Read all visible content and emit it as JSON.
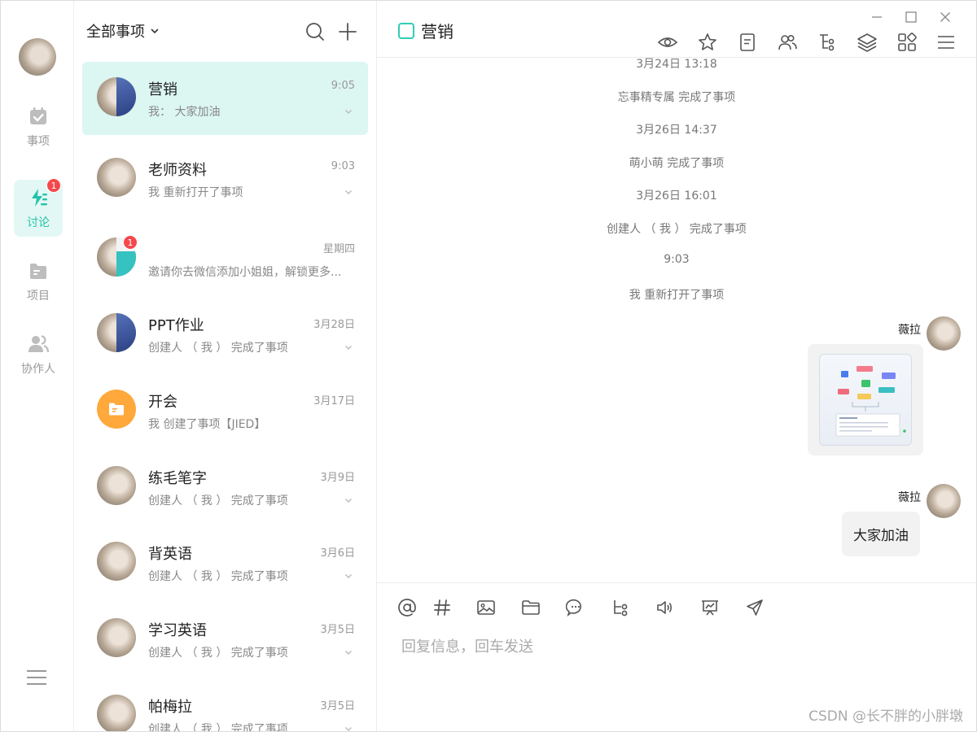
{
  "rail": {
    "items": [
      {
        "label": "事项",
        "icon": "calendar-check-icon"
      },
      {
        "label": "讨论",
        "icon": "lightning-icon",
        "badge": "1"
      },
      {
        "label": "项目",
        "icon": "folder-icon"
      },
      {
        "label": "协作人",
        "icon": "people-icon"
      }
    ]
  },
  "list": {
    "filter_label": "全部事项",
    "conversations": [
      {
        "title": "营销",
        "time": "9:05",
        "subtitle": "我： 大家加油"
      },
      {
        "title": "老师资料",
        "time": "9:03",
        "subtitle": "我 重新打开了事项"
      },
      {
        "title": "",
        "time": "星期四",
        "subtitle": "邀请你去微信添加小姐姐，解锁更多...",
        "badge": "1"
      },
      {
        "title": "PPT作业",
        "time": "3月28日",
        "subtitle": "创建人 （ 我 ） 完成了事项"
      },
      {
        "title": "开会",
        "time": "3月17日",
        "subtitle": "我 创建了事项【JIED】"
      },
      {
        "title": "练毛笔字",
        "time": "3月9日",
        "subtitle": "创建人 （ 我 ） 完成了事项"
      },
      {
        "title": "背英语",
        "time": "3月6日",
        "subtitle": "创建人 （ 我 ） 完成了事项"
      },
      {
        "title": "学习英语",
        "time": "3月5日",
        "subtitle": "创建人 （ 我 ） 完成了事项"
      },
      {
        "title": "帕梅拉",
        "time": "3月5日",
        "subtitle": "创建人 （ 我 ） 完成了事项"
      }
    ]
  },
  "chat": {
    "title": "营销",
    "system_messages": [
      "3月24日 13:18",
      "忘事精专属 完成了事项",
      "3月26日 14:37",
      "萌小萌 完成了事项",
      "3月26日 16:01",
      "创建人 （ 我 ） 完成了事项",
      "9:03",
      "我 重新打开了事项"
    ],
    "messages": [
      {
        "sender": "薇拉",
        "type": "image"
      },
      {
        "sender": "薇拉",
        "type": "text",
        "text": "大家加油"
      }
    ],
    "composer_placeholder": "回复信息，回车发送"
  },
  "watermark": "CSDN @长不胖的小胖墩",
  "colors": {
    "accent": "#22c3a9",
    "active_bg": "#dcf6f2",
    "badge": "#f5484b"
  }
}
